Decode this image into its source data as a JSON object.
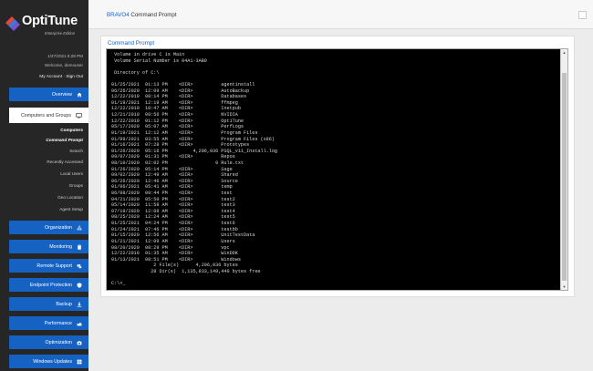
{
  "brand": {
    "name": "OptiTune",
    "edition": "Enterprise Edition",
    "colors": {
      "sidebar": "#262626",
      "accent": "#1662c3",
      "terminal": "#000000"
    }
  },
  "session": {
    "datetime": "1/27/2021 8:28 PM",
    "welcome": "Welcome, demouser",
    "links": "My Account · Sign Out"
  },
  "nav": {
    "overview": "Overview",
    "computers_groups": "Computers and Groups",
    "sub": {
      "computers": "Computers",
      "command_prompt": "Command Prompt",
      "search": "Search",
      "recently_accessed": "Recently Accessed",
      "local_users": "Local Users",
      "groups": "Groups",
      "geo_location": "Geo Location",
      "agent_setup": "Agent Setup"
    },
    "organization": "Organization",
    "monitoring": "Monitoring",
    "remote_support": "Remote Support",
    "endpoint_protection": "Endpoint Protection",
    "backup": "Backup",
    "performance": "Performance",
    "optimization": "Optimization",
    "windows_updates": "Windows Updates"
  },
  "header": {
    "device": "BRAVO4",
    "title": "Command Prompt"
  },
  "panel": {
    "title": "Command Prompt"
  },
  "terminal": {
    "lines": [
      " Volume in drive C is Main",
      " Volume Serial Number is 04A1-3AB9",
      "",
      " Directory of C:\\",
      "",
      "01/25/2021  01:13 PM    <DIR>          agentinstall",
      "06/26/2020  12:09 AM    <DIR>          AutoBackup",
      "12/22/2019  08:14 PM    <DIR>          Databases",
      "01/19/2021  12:19 AM    <DIR>          ffmpeg",
      "12/22/2019  10:47 AM    <DIR>          Inetpub",
      "12/21/2019  09:56 PM    <DIR>          NVIDIA",
      "12/22/2019  01:12 PM    <DIR>          OptiTune",
      "05/17/2020  05:07 AM    <DIR>          PerfLogs",
      "01/19/2021  12:12 AM    <DIR>          Program Files",
      "01/09/2021  03:55 AM    <DIR>          Program Files (x86)",
      "01/16/2021  07:28 PM    <DIR>          Prototypes",
      "01/26/2020  05:16 PM         4,206,036 PSQL_v11_Install.log",
      "09/07/2020  01:31 PM    <DIR>          Repos",
      "08/10/2020  02:02 PM                 0 Rule.txt",
      "01/26/2020  05:14 PM    <DIR>          Sage",
      "09/02/2020  12:49 AM    <DIR>          Shared",
      "06/26/2020  12:46 AM    <DIR>          Source",
      "01/06/2021  05:41 AM    <DIR>          temp",
      "06/08/2020  09:44 PM    <DIR>          test",
      "04/21/2020  05:50 PM    <DIR>          test2",
      "05/14/2020  11:58 AM    <DIR>          test3",
      "07/19/2020  12:09 AM    <DIR>          test4",
      "08/25/2020  12:24 AM    <DIR>          test5",
      "01/25/2021  04:24 PM    <DIR>          test6",
      "01/24/2021  07:46 PM    <DIR>          testbb",
      "01/15/2020  12:56 AM    <DIR>          UnitTestData",
      "01/21/2021  12:09 AM    <DIR>          Users",
      "08/20/2020  08:29 PM    <DIR>          vpc",
      "12/22/2019  01:35 AM    <DIR>          WinDDK",
      "01/13/2021  08:51 PM    <DIR>          Windows",
      "               2 File(s)      4,206,036 bytes",
      "              28 Dir(s)  1,135,833,149,440 bytes free",
      "",
      "C:\\>_"
    ]
  }
}
